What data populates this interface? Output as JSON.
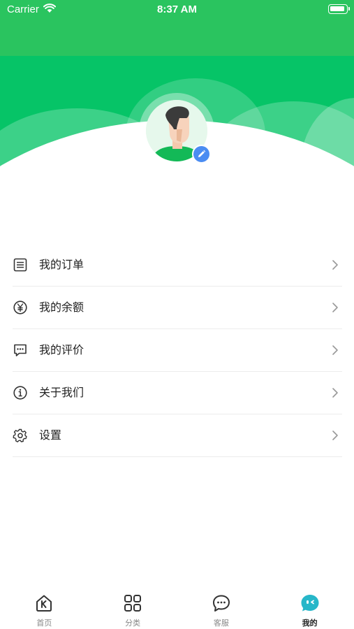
{
  "status_bar": {
    "carrier": "Carrier",
    "time": "8:37 AM"
  },
  "profile": {
    "avatar_icon": "user-avatar",
    "edit_icon": "pencil-icon"
  },
  "menu": [
    {
      "label": "我的订单",
      "icon": "list-icon"
    },
    {
      "label": "我的余额",
      "icon": "yen-icon"
    },
    {
      "label": "我的评价",
      "icon": "comment-icon"
    },
    {
      "label": "关于我们",
      "icon": "info-icon"
    },
    {
      "label": "设置",
      "icon": "gear-icon"
    }
  ],
  "tabbar": [
    {
      "label": "首页",
      "icon": "home-icon",
      "active": false
    },
    {
      "label": "分类",
      "icon": "grid-icon",
      "active": false
    },
    {
      "label": "客服",
      "icon": "chat-icon",
      "active": false
    },
    {
      "label": "我的",
      "icon": "profile-face-icon",
      "active": true
    }
  ],
  "colors": {
    "primary": "#06c467",
    "accent": "#4a8cf2",
    "active_tab": "#27b7c9"
  }
}
